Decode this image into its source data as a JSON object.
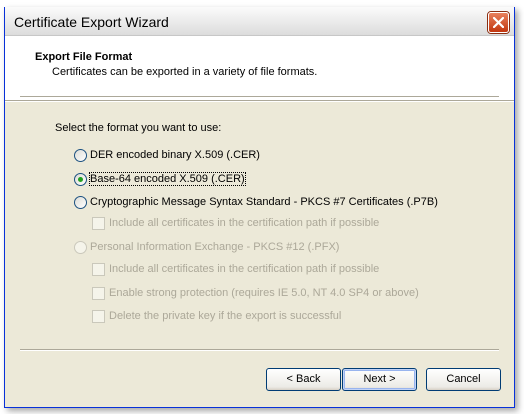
{
  "window": {
    "title": "Certificate Export Wizard"
  },
  "header": {
    "title": "Export File Format",
    "subtitle": "Certificates can be exported in a variety of file formats."
  },
  "body": {
    "prompt": "Select the format you want to use:",
    "options": [
      {
        "label": "DER encoded binary X.509 (.CER)",
        "selected": false,
        "enabled": true
      },
      {
        "label": "Base-64 encoded X.509 (.CER)",
        "selected": true,
        "enabled": true
      },
      {
        "label": "Cryptographic Message Syntax Standard - PKCS #7 Certificates (.P7B)",
        "selected": false,
        "enabled": true
      },
      {
        "label": "Personal Information Exchange - PKCS #12 (.PFX)",
        "selected": false,
        "enabled": false
      }
    ],
    "p7b_checkboxes": [
      {
        "label": "Include all certificates in the certification path if possible",
        "checked": false,
        "enabled": false
      }
    ],
    "pfx_checkboxes": [
      {
        "label": "Include all certificates in the certification path if possible",
        "checked": false,
        "enabled": false
      },
      {
        "label": "Enable strong protection (requires IE 5.0, NT 4.0 SP4 or above)",
        "checked": false,
        "enabled": false
      },
      {
        "label": "Delete the private key if the export is successful",
        "checked": false,
        "enabled": false
      }
    ]
  },
  "buttons": {
    "back": "< Back",
    "next": "Next >",
    "cancel": "Cancel"
  }
}
